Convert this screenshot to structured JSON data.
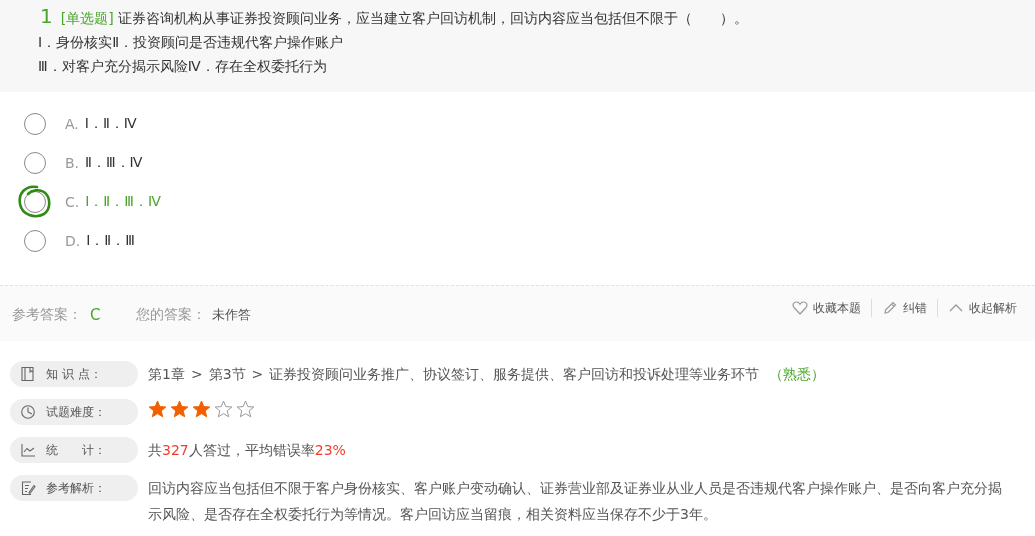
{
  "question": {
    "number": "1",
    "type": "[单选题]",
    "stem": "证券咨询机构从事证券投资顾问业务，应当建立客户回访机制，回访内容应当包括但不限于（　　）。",
    "lines": [
      "Ⅰ．身份核实Ⅱ．投资顾问是否违规代客户操作账户",
      "Ⅲ．对客户充分揭示风险Ⅳ．存在全权委托行为"
    ]
  },
  "options": [
    {
      "letter": "A.",
      "text": "Ⅰ．Ⅱ．Ⅳ",
      "correct": false,
      "selected": false
    },
    {
      "letter": "B.",
      "text": "Ⅱ．Ⅲ．Ⅳ",
      "correct": false,
      "selected": false
    },
    {
      "letter": "C.",
      "text": "Ⅰ．Ⅱ．Ⅲ．Ⅳ",
      "correct": true,
      "selected": false
    },
    {
      "letter": "D.",
      "text": "Ⅰ．Ⅱ．Ⅲ",
      "correct": false,
      "selected": false
    }
  ],
  "answer_bar": {
    "reference_label": "参考答案：",
    "reference_answer": "C",
    "your_label": "您的答案：",
    "your_answer": "未作答",
    "actions": [
      {
        "kind": "heart",
        "label": "收藏本题"
      },
      {
        "kind": "pencil",
        "label": "纠错"
      },
      {
        "kind": "caret",
        "label": "收起解析"
      }
    ]
  },
  "details": [
    {
      "kind": "knowledge",
      "label": "知 识 点：",
      "crumbs": [
        "第1章",
        "第3节",
        "证券投资顾问业务推广、协议签订、服务提供、客户回访和投诉处理等业务环节"
      ],
      "separator": ">",
      "tag": "（熟悉）"
    },
    {
      "kind": "difficulty",
      "label": "试题难度：",
      "stars": 3
    },
    {
      "kind": "stats",
      "label": "统　　计：",
      "segments": [
        {
          "text": "共",
          "highlight": false
        },
        {
          "text": "327",
          "highlight": true
        },
        {
          "text": "人答过，平均错误率",
          "highlight": false
        },
        {
          "text": "23%",
          "highlight": true
        }
      ]
    },
    {
      "kind": "analysis",
      "label": "参考解析：",
      "text": "回访内容应当包括但不限于客户身份核实、客户账户变动确认、证券营业部及证券业从业人员是否违规代客户操作账户、是否向客户充分揭示风险、是否存在全权委托行为等情况。客户回访应当留痕，相关资料应当保存不少于3年。"
    }
  ]
}
